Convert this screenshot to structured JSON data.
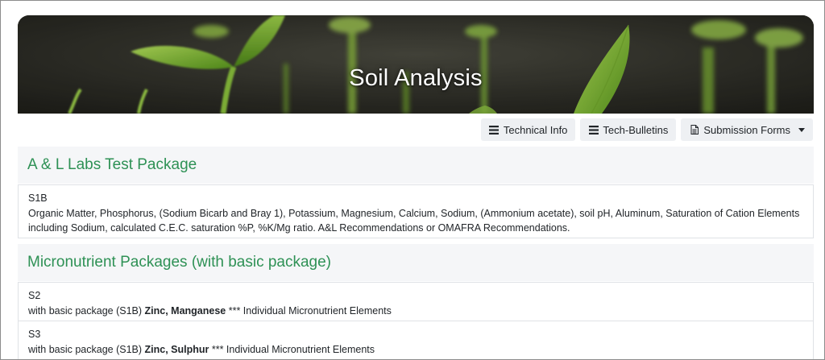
{
  "hero": {
    "title": "Soil Analysis"
  },
  "toolbar": {
    "technical_info": "Technical Info",
    "tech_bulletins": "Tech-Bulletins",
    "submission_forms": "Submission Forms"
  },
  "sections": [
    {
      "heading": "A & L Labs Test Package",
      "items": [
        {
          "code": "S1B",
          "description": "Organic Matter, Phosphorus, (Sodium Bicarb and Bray 1), Potassium, Magnesium, Calcium, Sodium, (Ammonium acetate), soil pH, Aluminum, Saturation of Cation Elements including Sodium, calculated C.E.C. saturation %P, %K/Mg ratio. A&L Recommendations or OMAFRA Recommendations."
        }
      ]
    },
    {
      "heading": "Micronutrient Packages (with basic package)",
      "items": [
        {
          "code": "S2",
          "prefix": "with basic package (S1B) ",
          "elements": "Zinc, Manganese",
          "suffix": " *** Individual Micronutrient Elements"
        },
        {
          "code": "S3",
          "prefix": "with basic package (S1B) ",
          "elements": "Zinc, Sulphur",
          "suffix": " *** Individual Micronutrient Elements"
        }
      ]
    }
  ],
  "colors": {
    "heading_green": "#2e9155",
    "section_bg": "#f5f6f8",
    "button_bg": "#eef0f3"
  },
  "icons": {
    "technical_info": "list-icon",
    "tech_bulletins": "list-icon",
    "submission_forms": "document-icon",
    "dropdown": "caret-down-icon"
  }
}
